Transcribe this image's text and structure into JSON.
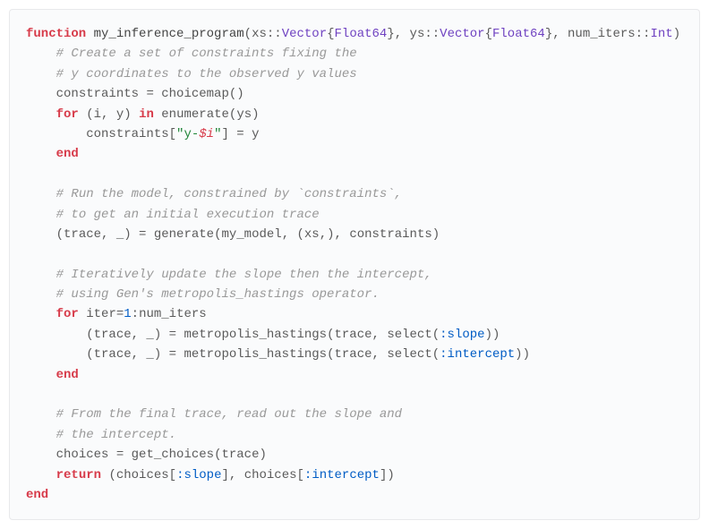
{
  "code": {
    "kw_function": "function",
    "fn_name": "my_inference_program",
    "param1": "xs",
    "ty_vec": "Vector",
    "ty_float": "Float64",
    "param2": "ys",
    "param3": "num_iters",
    "ty_int": "Int",
    "cm1": "# Create a set of constraints fixing the",
    "cm2": "# y coordinates to the observed y values",
    "var_constraints": "constraints",
    "fn_choicemap": "choicemap",
    "kw_for": "for",
    "loop1_vars": "(i, y)",
    "kw_in": "in",
    "fn_enumerate": "enumerate",
    "str_ykey": "\"y-",
    "interp_i": "$i",
    "str_close": "\"",
    "assign_y": "y",
    "kw_end": "end",
    "cm3": "# Run the model, constrained by `constraints`,",
    "cm4": "# to get an initial execution trace",
    "var_trace_tuple": "(trace, _)",
    "fn_generate": "generate",
    "arg_mymodel": "my_model",
    "arg_xs": "(xs,)",
    "cm5": "# Iteratively update the slope then the intercept,",
    "cm6": "# using Gen's metropolis_hastings operator.",
    "loop2_var": "iter",
    "num_1": "1",
    "var_numiters": "num_iters",
    "fn_mh": "metropolis_hastings",
    "arg_trace": "trace",
    "fn_select": "select",
    "sym_slope": ":slope",
    "sym_intercept": ":intercept",
    "cm7": "# From the final trace, read out the slope and",
    "cm8": "# the intercept.",
    "var_choices": "choices",
    "fn_getchoices": "get_choices",
    "kw_return": "return"
  }
}
